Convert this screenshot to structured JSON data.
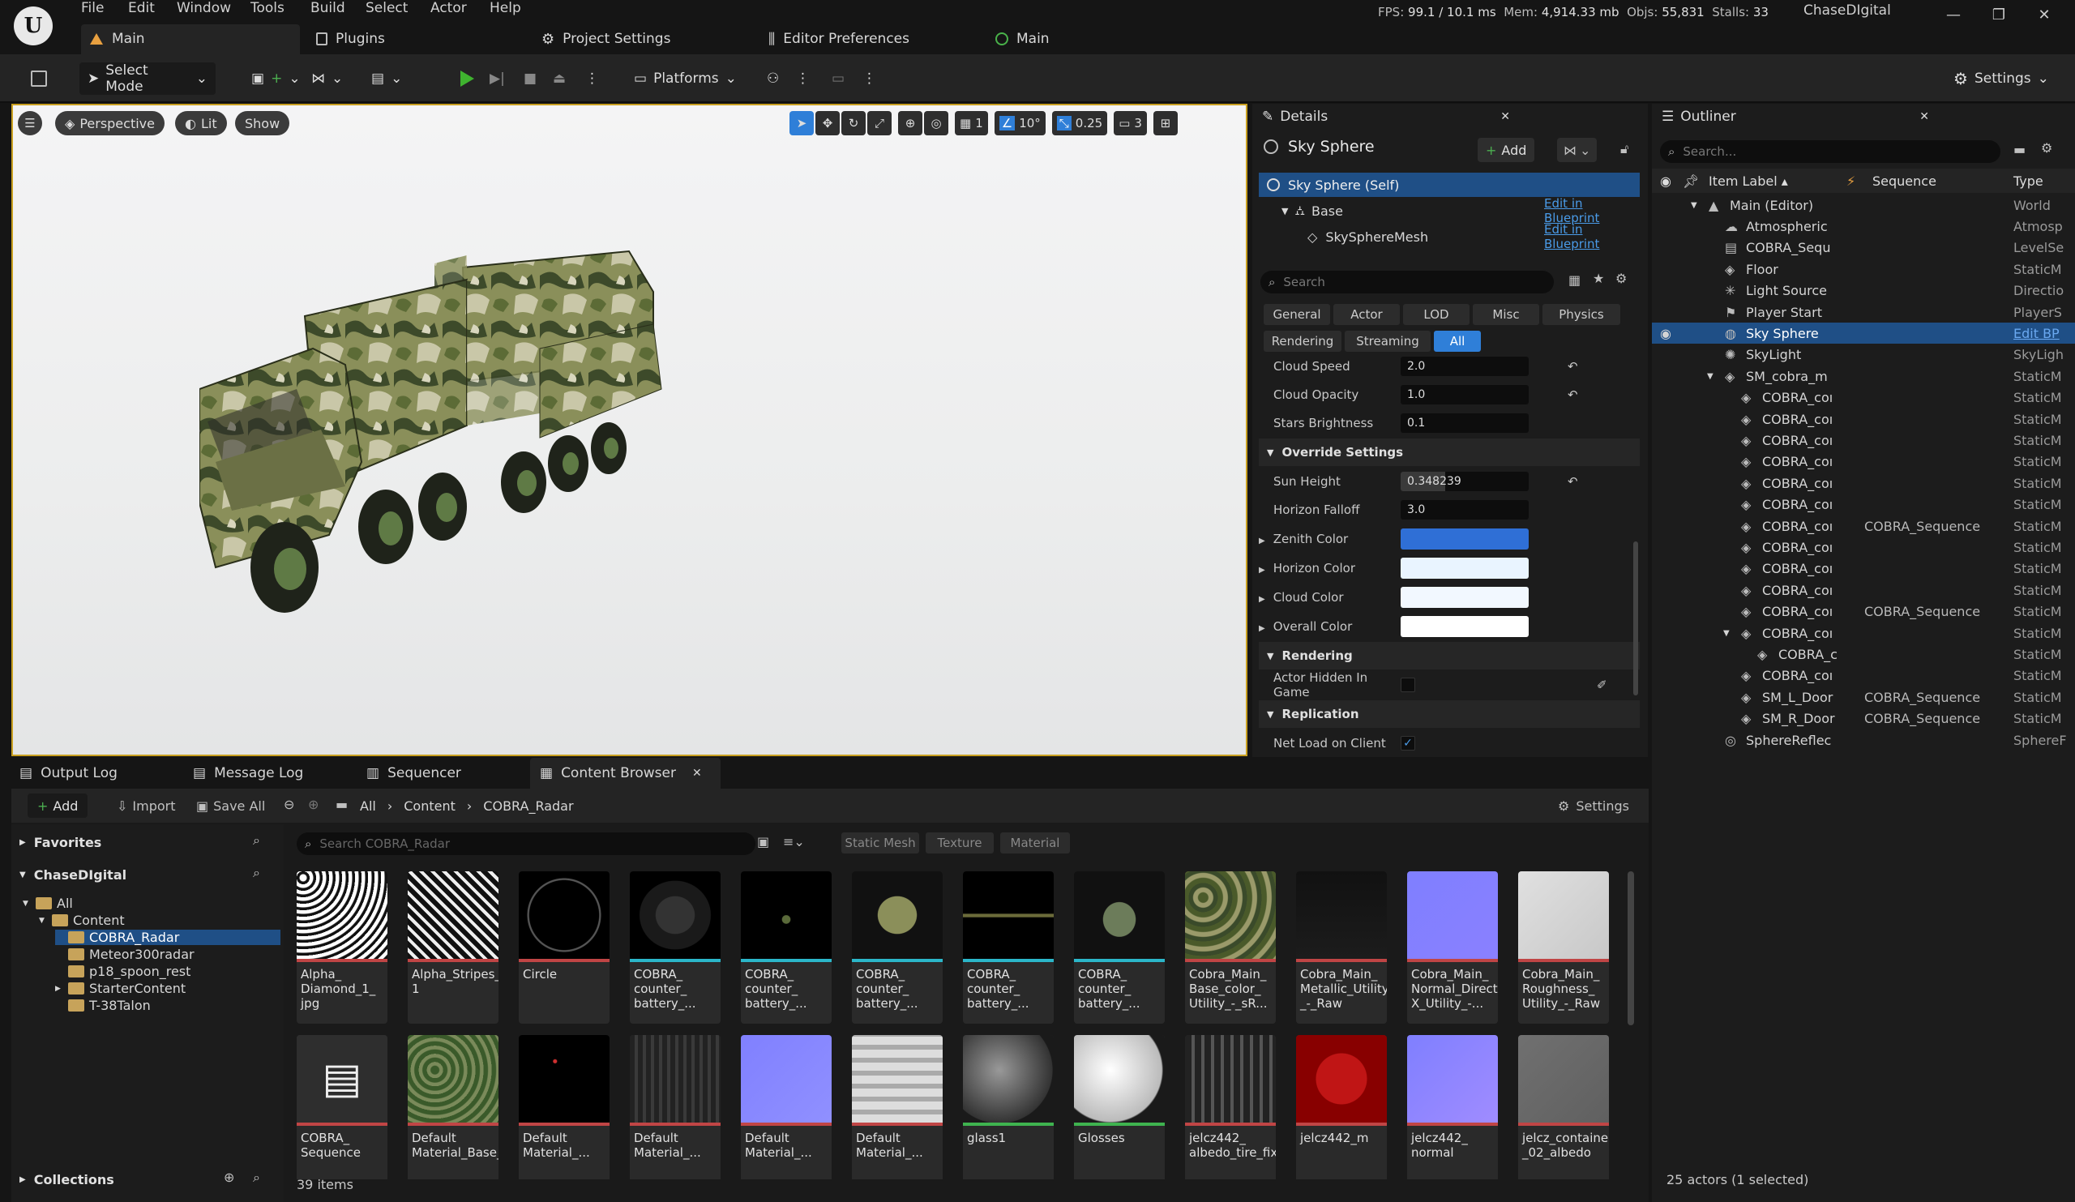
{
  "app": {
    "logo_letter": "U",
    "project_name": "ChaseDIgital"
  },
  "menu": [
    "File",
    "Edit",
    "Window",
    "Tools",
    "Build",
    "Select",
    "Actor",
    "Help"
  ],
  "doc_tabs": [
    {
      "label": "Main"
    },
    {
      "label": "Plugins"
    },
    {
      "label": "Project Settings"
    },
    {
      "label": "Editor Preferences"
    },
    {
      "label": "Main"
    }
  ],
  "stats": {
    "fps_label": "FPS:",
    "fps": "99.1",
    "ms": "/ 10.1 ms",
    "mem_label": "Mem:",
    "mem": "4,914.33 mb",
    "objs_label": "Objs:",
    "objs": "55,831",
    "stalls_label": "Stalls:",
    "stalls": "33"
  },
  "toolbar": {
    "select_mode": "Select Mode",
    "platforms": "Platforms",
    "settings": "Settings"
  },
  "viewport": {
    "perspective": "Perspective",
    "lit": "Lit",
    "show": "Show",
    "grid_value": "1",
    "angle_value": "10°",
    "scale_value": "0.25",
    "camera_speed": "3"
  },
  "details": {
    "tab_title": "Details",
    "actor_name": "Sky Sphere",
    "add_label": "Add",
    "self_label": "Sky Sphere (Self)",
    "base_label": "Base",
    "mesh_label": "SkySphereMesh",
    "edit_bp_1": "Edit in Blueprint",
    "edit_bp_2": "Edit in Blueprint",
    "search_placeholder": "Search",
    "categories": [
      "General",
      "Actor",
      "LOD",
      "Misc",
      "Physics",
      "Rendering",
      "Streaming",
      "All"
    ],
    "props_top": [
      {
        "label": "Cloud Speed",
        "value": "2.0"
      },
      {
        "label": "Cloud Opacity",
        "value": "1.0"
      },
      {
        "label": "Stars Brightness",
        "value": "0.1"
      }
    ],
    "override_section": "Override Settings",
    "sun_height": {
      "label": "Sun Height",
      "value": "0.348239",
      "fill": 0.35
    },
    "horizon_falloff": {
      "label": "Horizon Falloff",
      "value": "3.0"
    },
    "colors": [
      {
        "label": "Zenith Color",
        "color": "#2f6fd6"
      },
      {
        "label": "Horizon Color",
        "color": "#e9f4ff"
      },
      {
        "label": "Cloud Color",
        "color": "#f2f8ff"
      },
      {
        "label": "Overall Color",
        "color": "#ffffff"
      }
    ],
    "rendering_section": "Rendering",
    "hidden_in_game": {
      "label": "Actor Hidden In Game",
      "checked": false
    },
    "replication_section": "Replication",
    "net_load": {
      "label": "Net Load on Client",
      "checked": true
    }
  },
  "outliner": {
    "tab_title": "Outliner",
    "search_placeholder": "Search...",
    "col_label": "Item Label",
    "col_sequence": "Sequence",
    "col_type": "Type",
    "rows": [
      {
        "label": "Main (Editor)",
        "seq": "",
        "type": "World",
        "indent": 1,
        "icon": "world-icon"
      },
      {
        "label": "Atmospheric",
        "seq": "",
        "type": "Atmosp",
        "indent": 2,
        "icon": "atmosphere-icon"
      },
      {
        "label": "COBRA_Sequ",
        "seq": "",
        "type": "LevelSe",
        "indent": 2,
        "icon": "sequence-icon"
      },
      {
        "label": "Floor",
        "seq": "",
        "type": "StaticM",
        "indent": 2,
        "icon": "mesh-icon"
      },
      {
        "label": "Light Source",
        "seq": "",
        "type": "Directio",
        "indent": 2,
        "icon": "light-icon"
      },
      {
        "label": "Player Start",
        "seq": "",
        "type": "PlayerS",
        "indent": 2,
        "icon": "player-start-icon"
      },
      {
        "label": "Sky Sphere",
        "seq": "",
        "type": "Edit BP",
        "indent": 2,
        "icon": "sky-sphere-icon",
        "selected": true
      },
      {
        "label": "SkyLight",
        "seq": "",
        "type": "SkyLigh",
        "indent": 2,
        "icon": "skylight-icon"
      },
      {
        "label": "SM_cobra_m",
        "seq": "",
        "type": "StaticM",
        "indent": 2,
        "icon": "mesh-icon",
        "expand": true
      },
      {
        "label": "COBRA_coı",
        "seq": "",
        "type": "StaticM",
        "indent": 3,
        "icon": "mesh-icon"
      },
      {
        "label": "COBRA_coı",
        "seq": "",
        "type": "StaticM",
        "indent": 3,
        "icon": "mesh-icon"
      },
      {
        "label": "COBRA_coı",
        "seq": "",
        "type": "StaticM",
        "indent": 3,
        "icon": "mesh-icon"
      },
      {
        "label": "COBRA_coı",
        "seq": "",
        "type": "StaticM",
        "indent": 3,
        "icon": "mesh-icon"
      },
      {
        "label": "COBRA_coı",
        "seq": "",
        "type": "StaticM",
        "indent": 3,
        "icon": "mesh-icon"
      },
      {
        "label": "COBRA_coı",
        "seq": "",
        "type": "StaticM",
        "indent": 3,
        "icon": "mesh-icon"
      },
      {
        "label": "COBRA_coı",
        "seq": "COBRA_Sequence",
        "type": "StaticM",
        "indent": 3,
        "icon": "mesh-icon"
      },
      {
        "label": "COBRA_coı",
        "seq": "",
        "type": "StaticM",
        "indent": 3,
        "icon": "mesh-icon"
      },
      {
        "label": "COBRA_coı",
        "seq": "",
        "type": "StaticM",
        "indent": 3,
        "icon": "mesh-icon"
      },
      {
        "label": "COBRA_coı",
        "seq": "",
        "type": "StaticM",
        "indent": 3,
        "icon": "mesh-icon"
      },
      {
        "label": "COBRA_coı",
        "seq": "COBRA_Sequence",
        "type": "StaticM",
        "indent": 3,
        "icon": "mesh-icon"
      },
      {
        "label": "COBRA_coı",
        "seq": "",
        "type": "StaticM",
        "indent": 3,
        "icon": "mesh-icon",
        "expand": true
      },
      {
        "label": "COBRA_c",
        "seq": "",
        "type": "StaticM",
        "indent": 4,
        "icon": "mesh-icon"
      },
      {
        "label": "COBRA_coı",
        "seq": "",
        "type": "StaticM",
        "indent": 3,
        "icon": "mesh-icon"
      },
      {
        "label": "SM_L_Door",
        "seq": "COBRA_Sequence",
        "type": "StaticM",
        "indent": 3,
        "icon": "mesh-icon"
      },
      {
        "label": "SM_R_Door",
        "seq": "COBRA_Sequence",
        "type": "StaticM",
        "indent": 3,
        "icon": "mesh-icon"
      },
      {
        "label": "SphereReflec",
        "seq": "",
        "type": "SphereF",
        "indent": 2,
        "icon": "reflection-icon"
      }
    ],
    "footer": "25 actors (1 selected)"
  },
  "bottom_tabs": [
    {
      "label": "Output Log"
    },
    {
      "label": "Message Log"
    },
    {
      "label": "Sequencer"
    },
    {
      "label": "Content Browser"
    }
  ],
  "content_browser": {
    "add": "Add",
    "import": "Import",
    "save_all": "Save All",
    "path": [
      "All",
      "Content",
      "COBRA_Radar"
    ],
    "settings": "Settings",
    "favorites": "Favorites",
    "project": "ChaseDIgital",
    "search_placeholder": "Search COBRA_Radar",
    "filters": [
      "Static Mesh",
      "Texture",
      "Material"
    ],
    "tree": [
      {
        "label": "All",
        "indent": 0
      },
      {
        "label": "Content",
        "indent": 1
      },
      {
        "label": "COBRA_Radar",
        "indent": 2,
        "selected": true
      },
      {
        "label": "Meteor300radar",
        "indent": 2
      },
      {
        "label": "p18_spoon_rest",
        "indent": 2
      },
      {
        "label": "StarterContent",
        "indent": 2
      },
      {
        "label": "T-38Talon",
        "indent": 2
      }
    ],
    "collections": "Collections",
    "item_count": "39 items",
    "assets": [
      {
        "name": "Alpha_ Diamond_1_ jpg",
        "kind": "texture"
      },
      {
        "name": "Alpha_Stripes_ 1",
        "kind": "texture"
      },
      {
        "name": "Circle",
        "kind": "texture"
      },
      {
        "name": "COBRA_ counter_ battery_...",
        "kind": "mesh"
      },
      {
        "name": "COBRA_ counter_ battery_...",
        "kind": "mesh"
      },
      {
        "name": "COBRA_ counter_ battery_...",
        "kind": "mesh"
      },
      {
        "name": "COBRA_ counter_ battery_...",
        "kind": "mesh"
      },
      {
        "name": "COBRA_ counter_ battery_...",
        "kind": "mesh"
      },
      {
        "name": "Cobra_Main_ Base_color_ Utility_-_sR...",
        "kind": "texture"
      },
      {
        "name": "Cobra_Main_ Metallic_Utility _-_Raw",
        "kind": "texture"
      },
      {
        "name": "Cobra_Main_ Normal_Direct X_Utility_-...",
        "kind": "texture"
      },
      {
        "name": "Cobra_Main_ Roughness_ Utility_-_Raw",
        "kind": "texture"
      },
      {
        "name": "COBRA_ Sequence",
        "kind": "sequence"
      },
      {
        "name": "Default Material_Base_...",
        "kind": "texture"
      },
      {
        "name": "Default Material_...",
        "kind": "texture"
      },
      {
        "name": "Default Material_...",
        "kind": "texture"
      },
      {
        "name": "Default Material_...",
        "kind": "texture"
      },
      {
        "name": "Default Material_...",
        "kind": "texture"
      },
      {
        "name": "glass1",
        "kind": "material"
      },
      {
        "name": "Glosses",
        "kind": "material"
      },
      {
        "name": "jelcz442_ albedo_tire_fix",
        "kind": "texture"
      },
      {
        "name": "jelcz442_m",
        "kind": "texture"
      },
      {
        "name": "jelcz442_ normal",
        "kind": "texture"
      },
      {
        "name": "jelcz_container _02_albedo",
        "kind": "texture"
      }
    ]
  },
  "colors": {
    "accent_blue": "#2f7fd8",
    "selected_row": "#1f4f86",
    "play_green": "#3fb32f",
    "viewport_border": "#c9a020",
    "texture_bar": "#c04545",
    "mesh_bar": "#2bb6c9",
    "material_bar": "#3fb34f"
  }
}
